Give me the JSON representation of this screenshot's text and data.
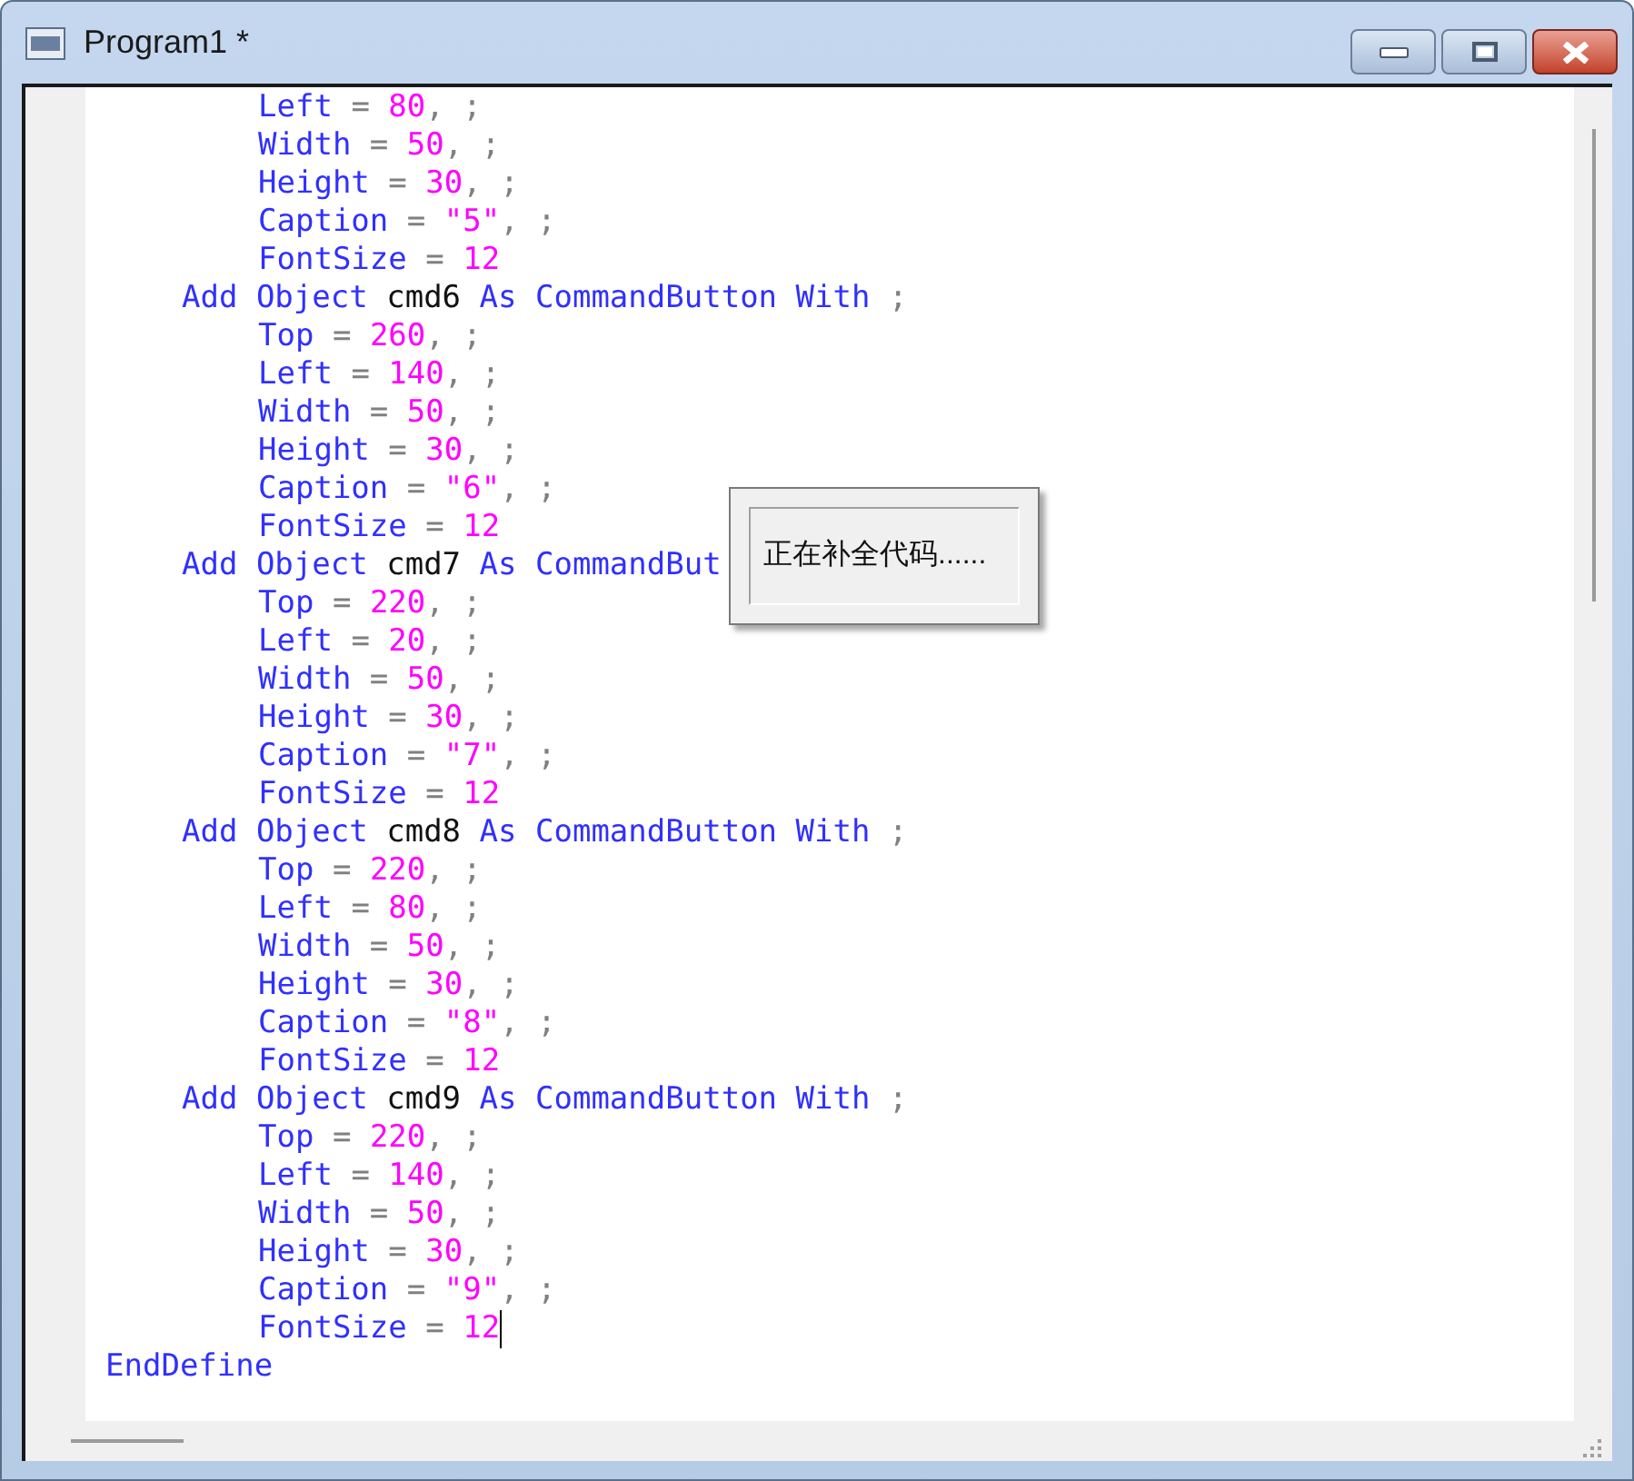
{
  "window": {
    "title": "Program1 *"
  },
  "editor": {
    "lines": [
      {
        "kind": "property",
        "caret": false,
        "tokens": [
          {
            "kind": "keyword",
            "text": "Left"
          },
          {
            "kind": "op",
            "text": " = "
          },
          {
            "kind": "literal",
            "text": "80"
          },
          {
            "kind": "op",
            "text": ", ;"
          }
        ]
      },
      {
        "kind": "property",
        "caret": false,
        "tokens": [
          {
            "kind": "keyword",
            "text": "Width"
          },
          {
            "kind": "op",
            "text": " = "
          },
          {
            "kind": "literal",
            "text": "50"
          },
          {
            "kind": "op",
            "text": ", ;"
          }
        ]
      },
      {
        "kind": "property",
        "caret": false,
        "tokens": [
          {
            "kind": "keyword",
            "text": "Height"
          },
          {
            "kind": "op",
            "text": " = "
          },
          {
            "kind": "literal",
            "text": "30"
          },
          {
            "kind": "op",
            "text": ", ;"
          }
        ]
      },
      {
        "kind": "property",
        "caret": false,
        "tokens": [
          {
            "kind": "keyword",
            "text": "Caption"
          },
          {
            "kind": "op",
            "text": " = "
          },
          {
            "kind": "literal",
            "text": "\"5\""
          },
          {
            "kind": "op",
            "text": ", ;"
          }
        ]
      },
      {
        "kind": "property",
        "caret": false,
        "tokens": [
          {
            "kind": "keyword",
            "text": "FontSize"
          },
          {
            "kind": "op",
            "text": " = "
          },
          {
            "kind": "literal",
            "text": "12"
          }
        ]
      },
      {
        "kind": "object",
        "caret": false,
        "tokens": [
          {
            "kind": "keyword",
            "text": "Add Object "
          },
          {
            "kind": "ident",
            "text": "cmd6"
          },
          {
            "kind": "keyword",
            "text": " As CommandButton With "
          },
          {
            "kind": "op",
            "text": ";"
          }
        ]
      },
      {
        "kind": "property",
        "caret": false,
        "tokens": [
          {
            "kind": "keyword",
            "text": "Top"
          },
          {
            "kind": "op",
            "text": " = "
          },
          {
            "kind": "literal",
            "text": "260"
          },
          {
            "kind": "op",
            "text": ", ;"
          }
        ]
      },
      {
        "kind": "property",
        "caret": false,
        "tokens": [
          {
            "kind": "keyword",
            "text": "Left"
          },
          {
            "kind": "op",
            "text": " = "
          },
          {
            "kind": "literal",
            "text": "140"
          },
          {
            "kind": "op",
            "text": ", ;"
          }
        ]
      },
      {
        "kind": "property",
        "caret": false,
        "tokens": [
          {
            "kind": "keyword",
            "text": "Width"
          },
          {
            "kind": "op",
            "text": " = "
          },
          {
            "kind": "literal",
            "text": "50"
          },
          {
            "kind": "op",
            "text": ", ;"
          }
        ]
      },
      {
        "kind": "property",
        "caret": false,
        "tokens": [
          {
            "kind": "keyword",
            "text": "Height"
          },
          {
            "kind": "op",
            "text": " = "
          },
          {
            "kind": "literal",
            "text": "30"
          },
          {
            "kind": "op",
            "text": ", ;"
          }
        ]
      },
      {
        "kind": "property",
        "caret": false,
        "tokens": [
          {
            "kind": "keyword",
            "text": "Caption"
          },
          {
            "kind": "op",
            "text": " = "
          },
          {
            "kind": "literal",
            "text": "\"6\""
          },
          {
            "kind": "op",
            "text": ", ;"
          }
        ]
      },
      {
        "kind": "property",
        "caret": false,
        "tokens": [
          {
            "kind": "keyword",
            "text": "FontSize"
          },
          {
            "kind": "op",
            "text": " = "
          },
          {
            "kind": "literal",
            "text": "12"
          }
        ]
      },
      {
        "kind": "object",
        "caret": false,
        "tokens": [
          {
            "kind": "keyword",
            "text": "Add Object "
          },
          {
            "kind": "ident",
            "text": "cmd7"
          },
          {
            "kind": "keyword",
            "text": " As CommandBut"
          }
        ]
      },
      {
        "kind": "property",
        "caret": false,
        "tokens": [
          {
            "kind": "keyword",
            "text": "Top"
          },
          {
            "kind": "op",
            "text": " = "
          },
          {
            "kind": "literal",
            "text": "220"
          },
          {
            "kind": "op",
            "text": ", ;"
          }
        ]
      },
      {
        "kind": "property",
        "caret": false,
        "tokens": [
          {
            "kind": "keyword",
            "text": "Left"
          },
          {
            "kind": "op",
            "text": " = "
          },
          {
            "kind": "literal",
            "text": "20"
          },
          {
            "kind": "op",
            "text": ", ;"
          }
        ]
      },
      {
        "kind": "property",
        "caret": false,
        "tokens": [
          {
            "kind": "keyword",
            "text": "Width"
          },
          {
            "kind": "op",
            "text": " = "
          },
          {
            "kind": "literal",
            "text": "50"
          },
          {
            "kind": "op",
            "text": ", ;"
          }
        ]
      },
      {
        "kind": "property",
        "caret": false,
        "tokens": [
          {
            "kind": "keyword",
            "text": "Height"
          },
          {
            "kind": "op",
            "text": " = "
          },
          {
            "kind": "literal",
            "text": "30"
          },
          {
            "kind": "op",
            "text": ", ;"
          }
        ]
      },
      {
        "kind": "property",
        "caret": false,
        "tokens": [
          {
            "kind": "keyword",
            "text": "Caption"
          },
          {
            "kind": "op",
            "text": " = "
          },
          {
            "kind": "literal",
            "text": "\"7\""
          },
          {
            "kind": "op",
            "text": ", ;"
          }
        ]
      },
      {
        "kind": "property",
        "caret": false,
        "tokens": [
          {
            "kind": "keyword",
            "text": "FontSize"
          },
          {
            "kind": "op",
            "text": " = "
          },
          {
            "kind": "literal",
            "text": "12"
          }
        ]
      },
      {
        "kind": "object",
        "caret": false,
        "tokens": [
          {
            "kind": "keyword",
            "text": "Add Object "
          },
          {
            "kind": "ident",
            "text": "cmd8"
          },
          {
            "kind": "keyword",
            "text": " As CommandButton With "
          },
          {
            "kind": "op",
            "text": ";"
          }
        ]
      },
      {
        "kind": "property",
        "caret": false,
        "tokens": [
          {
            "kind": "keyword",
            "text": "Top"
          },
          {
            "kind": "op",
            "text": " = "
          },
          {
            "kind": "literal",
            "text": "220"
          },
          {
            "kind": "op",
            "text": ", ;"
          }
        ]
      },
      {
        "kind": "property",
        "caret": false,
        "tokens": [
          {
            "kind": "keyword",
            "text": "Left"
          },
          {
            "kind": "op",
            "text": " = "
          },
          {
            "kind": "literal",
            "text": "80"
          },
          {
            "kind": "op",
            "text": ", ;"
          }
        ]
      },
      {
        "kind": "property",
        "caret": false,
        "tokens": [
          {
            "kind": "keyword",
            "text": "Width"
          },
          {
            "kind": "op",
            "text": " = "
          },
          {
            "kind": "literal",
            "text": "50"
          },
          {
            "kind": "op",
            "text": ", ;"
          }
        ]
      },
      {
        "kind": "property",
        "caret": false,
        "tokens": [
          {
            "kind": "keyword",
            "text": "Height"
          },
          {
            "kind": "op",
            "text": " = "
          },
          {
            "kind": "literal",
            "text": "30"
          },
          {
            "kind": "op",
            "text": ", ;"
          }
        ]
      },
      {
        "kind": "property",
        "caret": false,
        "tokens": [
          {
            "kind": "keyword",
            "text": "Caption"
          },
          {
            "kind": "op",
            "text": " = "
          },
          {
            "kind": "literal",
            "text": "\"8\""
          },
          {
            "kind": "op",
            "text": ", ;"
          }
        ]
      },
      {
        "kind": "property",
        "caret": false,
        "tokens": [
          {
            "kind": "keyword",
            "text": "FontSize"
          },
          {
            "kind": "op",
            "text": " = "
          },
          {
            "kind": "literal",
            "text": "12"
          }
        ]
      },
      {
        "kind": "object",
        "caret": false,
        "tokens": [
          {
            "kind": "keyword",
            "text": "Add Object "
          },
          {
            "kind": "ident",
            "text": "cmd9"
          },
          {
            "kind": "keyword",
            "text": " As CommandButton With "
          },
          {
            "kind": "op",
            "text": ";"
          }
        ]
      },
      {
        "kind": "property",
        "caret": false,
        "tokens": [
          {
            "kind": "keyword",
            "text": "Top"
          },
          {
            "kind": "op",
            "text": " = "
          },
          {
            "kind": "literal",
            "text": "220"
          },
          {
            "kind": "op",
            "text": ", ;"
          }
        ]
      },
      {
        "kind": "property",
        "caret": false,
        "tokens": [
          {
            "kind": "keyword",
            "text": "Left"
          },
          {
            "kind": "op",
            "text": " = "
          },
          {
            "kind": "literal",
            "text": "140"
          },
          {
            "kind": "op",
            "text": ", ;"
          }
        ]
      },
      {
        "kind": "property",
        "caret": false,
        "tokens": [
          {
            "kind": "keyword",
            "text": "Width"
          },
          {
            "kind": "op",
            "text": " = "
          },
          {
            "kind": "literal",
            "text": "50"
          },
          {
            "kind": "op",
            "text": ", ;"
          }
        ]
      },
      {
        "kind": "property",
        "caret": false,
        "tokens": [
          {
            "kind": "keyword",
            "text": "Height"
          },
          {
            "kind": "op",
            "text": " = "
          },
          {
            "kind": "literal",
            "text": "30"
          },
          {
            "kind": "op",
            "text": ", ;"
          }
        ]
      },
      {
        "kind": "property",
        "caret": false,
        "tokens": [
          {
            "kind": "keyword",
            "text": "Caption"
          },
          {
            "kind": "op",
            "text": " = "
          },
          {
            "kind": "literal",
            "text": "\"9\""
          },
          {
            "kind": "op",
            "text": ", ;"
          }
        ]
      },
      {
        "kind": "property",
        "caret": true,
        "tokens": [
          {
            "kind": "keyword",
            "text": "FontSize"
          },
          {
            "kind": "op",
            "text": " = "
          },
          {
            "kind": "literal",
            "text": "12"
          }
        ]
      },
      {
        "kind": "end",
        "caret": false,
        "tokens": [
          {
            "kind": "keyword",
            "text": "EndDefine"
          }
        ]
      }
    ]
  },
  "popup": {
    "message": "正在补全代码......"
  }
}
